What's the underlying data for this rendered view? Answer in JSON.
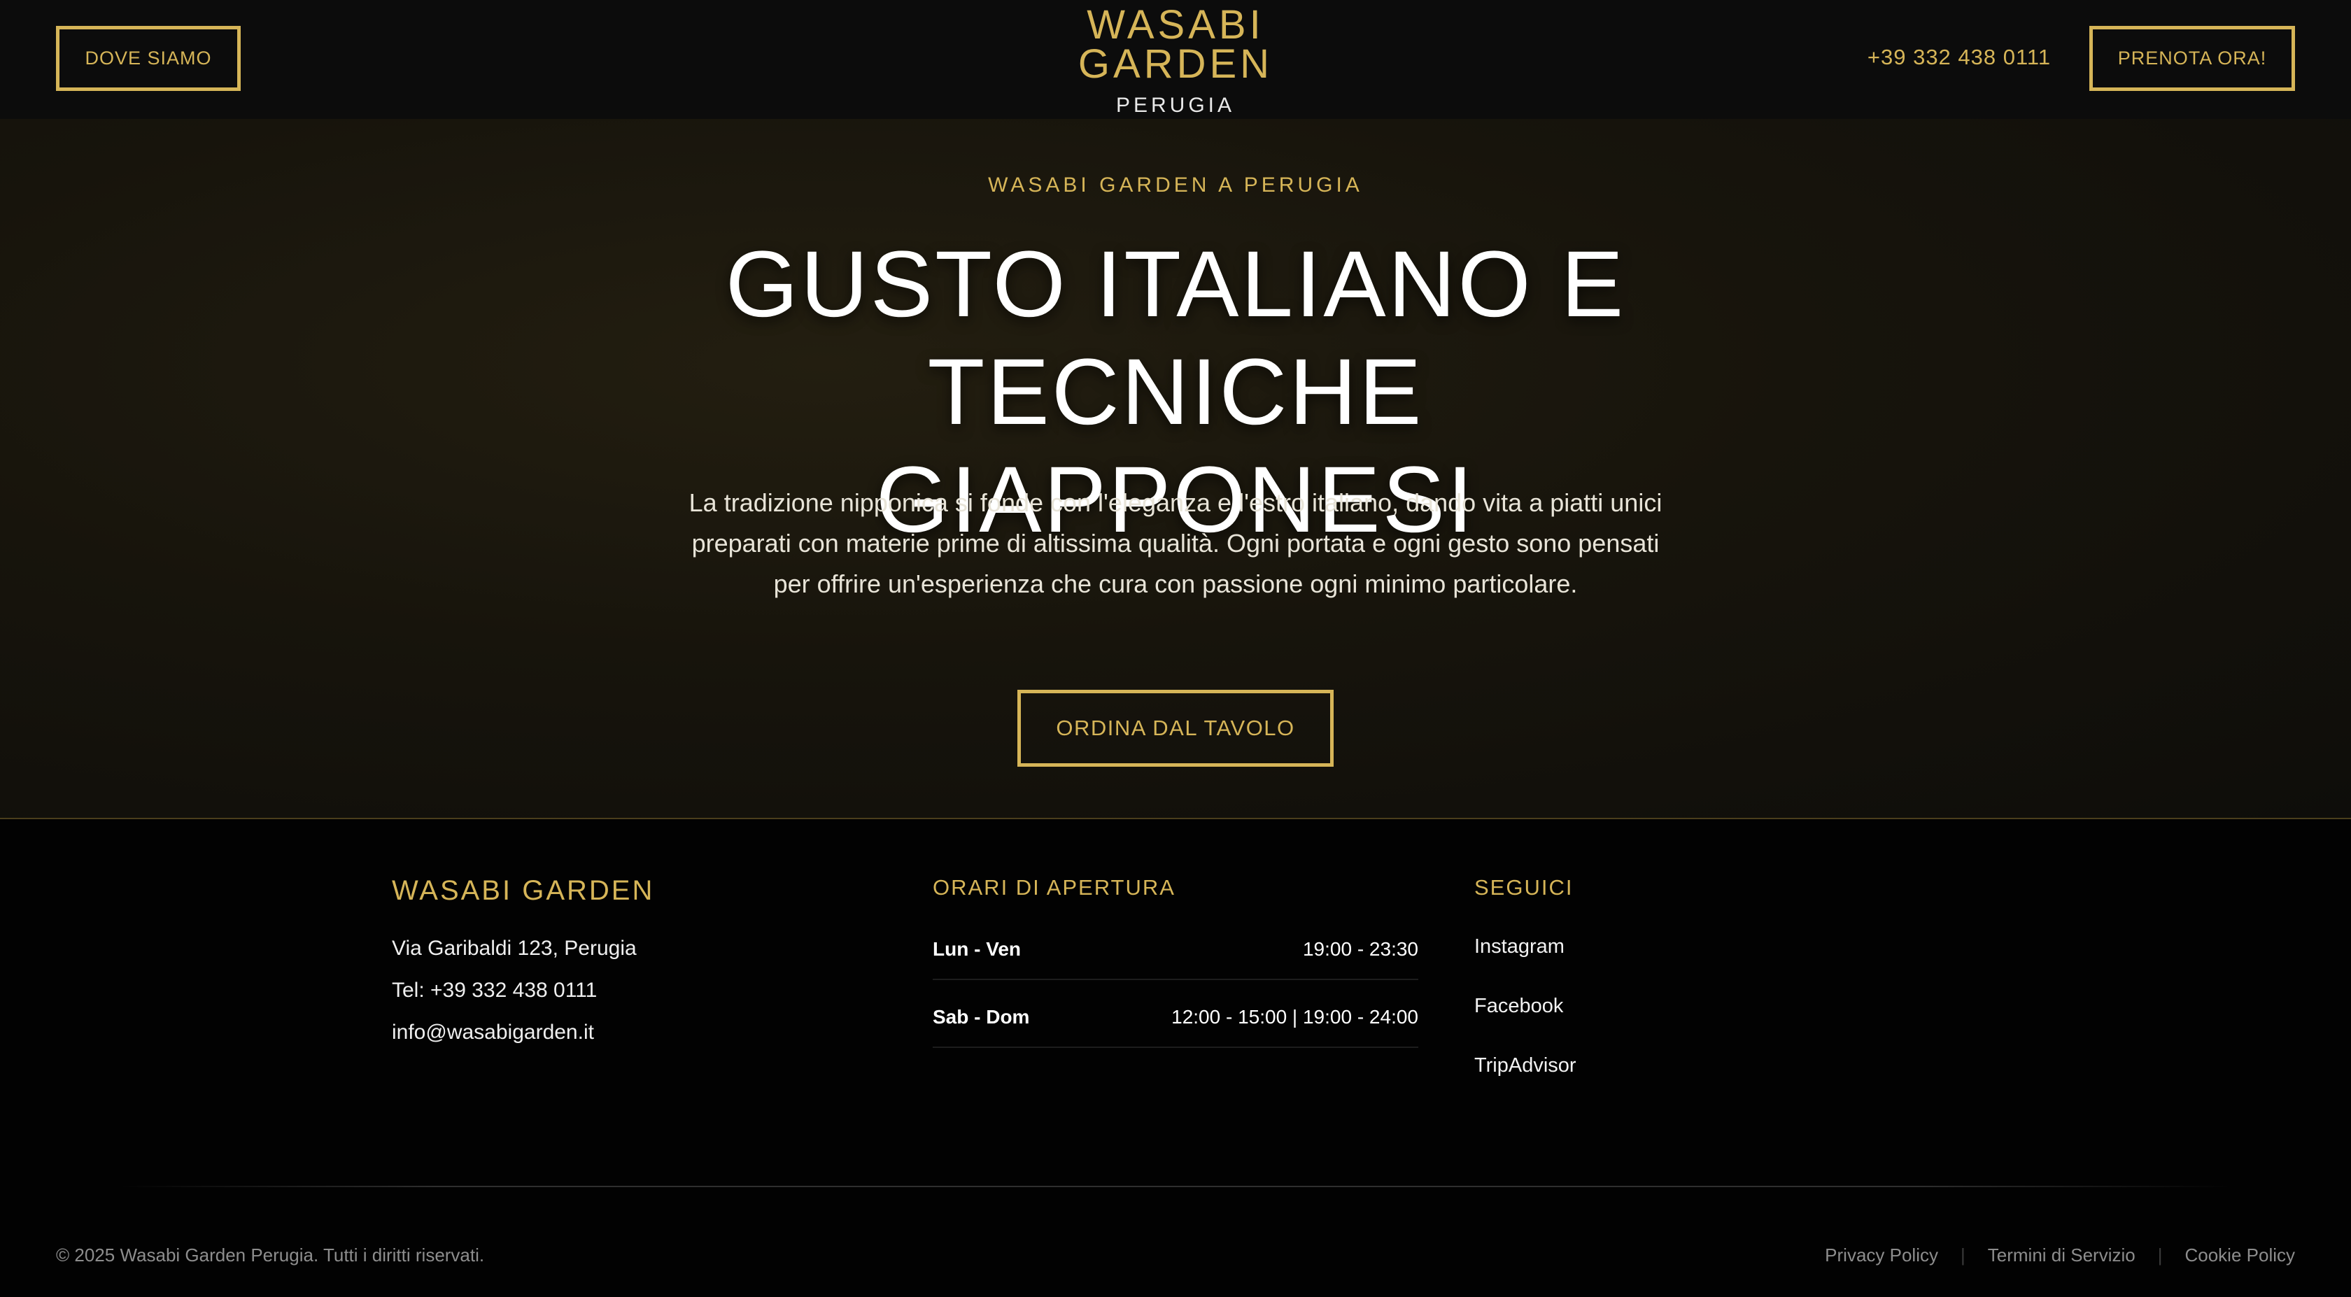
{
  "header": {
    "location_button": "DOVE SIAMO",
    "logo_line1": "WASABI",
    "logo_line2": "GARDEN",
    "logo_city": "PERUGIA",
    "phone": "+39 332 438 0111",
    "booking_button": "PRENOTA ORA!"
  },
  "hero": {
    "eyebrow": "WASABI GARDEN A PERUGIA",
    "title_line1": "GUSTO ITALIANO E",
    "title_line2": "TECNICHE GIAPPONESI",
    "description": "La tradizione nipponica si fonde con l'eleganza e l'estro italiano, dando vita a piatti unici preparati con materie prime di altissima qualità. Ogni portata e ogni gesto sono pensati per offrire un'esperienza che cura con passione ogni minimo particolare.",
    "cta": "ORDINA DAL TAVOLO"
  },
  "footer": {
    "brand": "WASABI GARDEN",
    "address": "Via Garibaldi 123, Perugia",
    "tel": "Tel: +39 332 438 0111",
    "email": "info@wasabigarden.it",
    "hours_title": "ORARI DI APERTURA",
    "hours": [
      {
        "day": "Lun - Ven",
        "time": "19:00 - 23:30"
      },
      {
        "day": "Sab - Dom",
        "time": "12:00 - 15:00 | 19:00 - 24:00"
      }
    ],
    "social_title": "SEGUICI",
    "social": [
      "Instagram",
      "Facebook",
      "TripAdvisor"
    ],
    "copyright": "© 2025 Wasabi Garden Perugia. Tutti i diritti riservati.",
    "legal": [
      "Privacy Policy",
      "Termini di Servizio",
      "Cookie Policy"
    ]
  },
  "colors": {
    "accent_gold": "#d6b558",
    "background": "#030303",
    "hero_background": "#1a1710"
  }
}
